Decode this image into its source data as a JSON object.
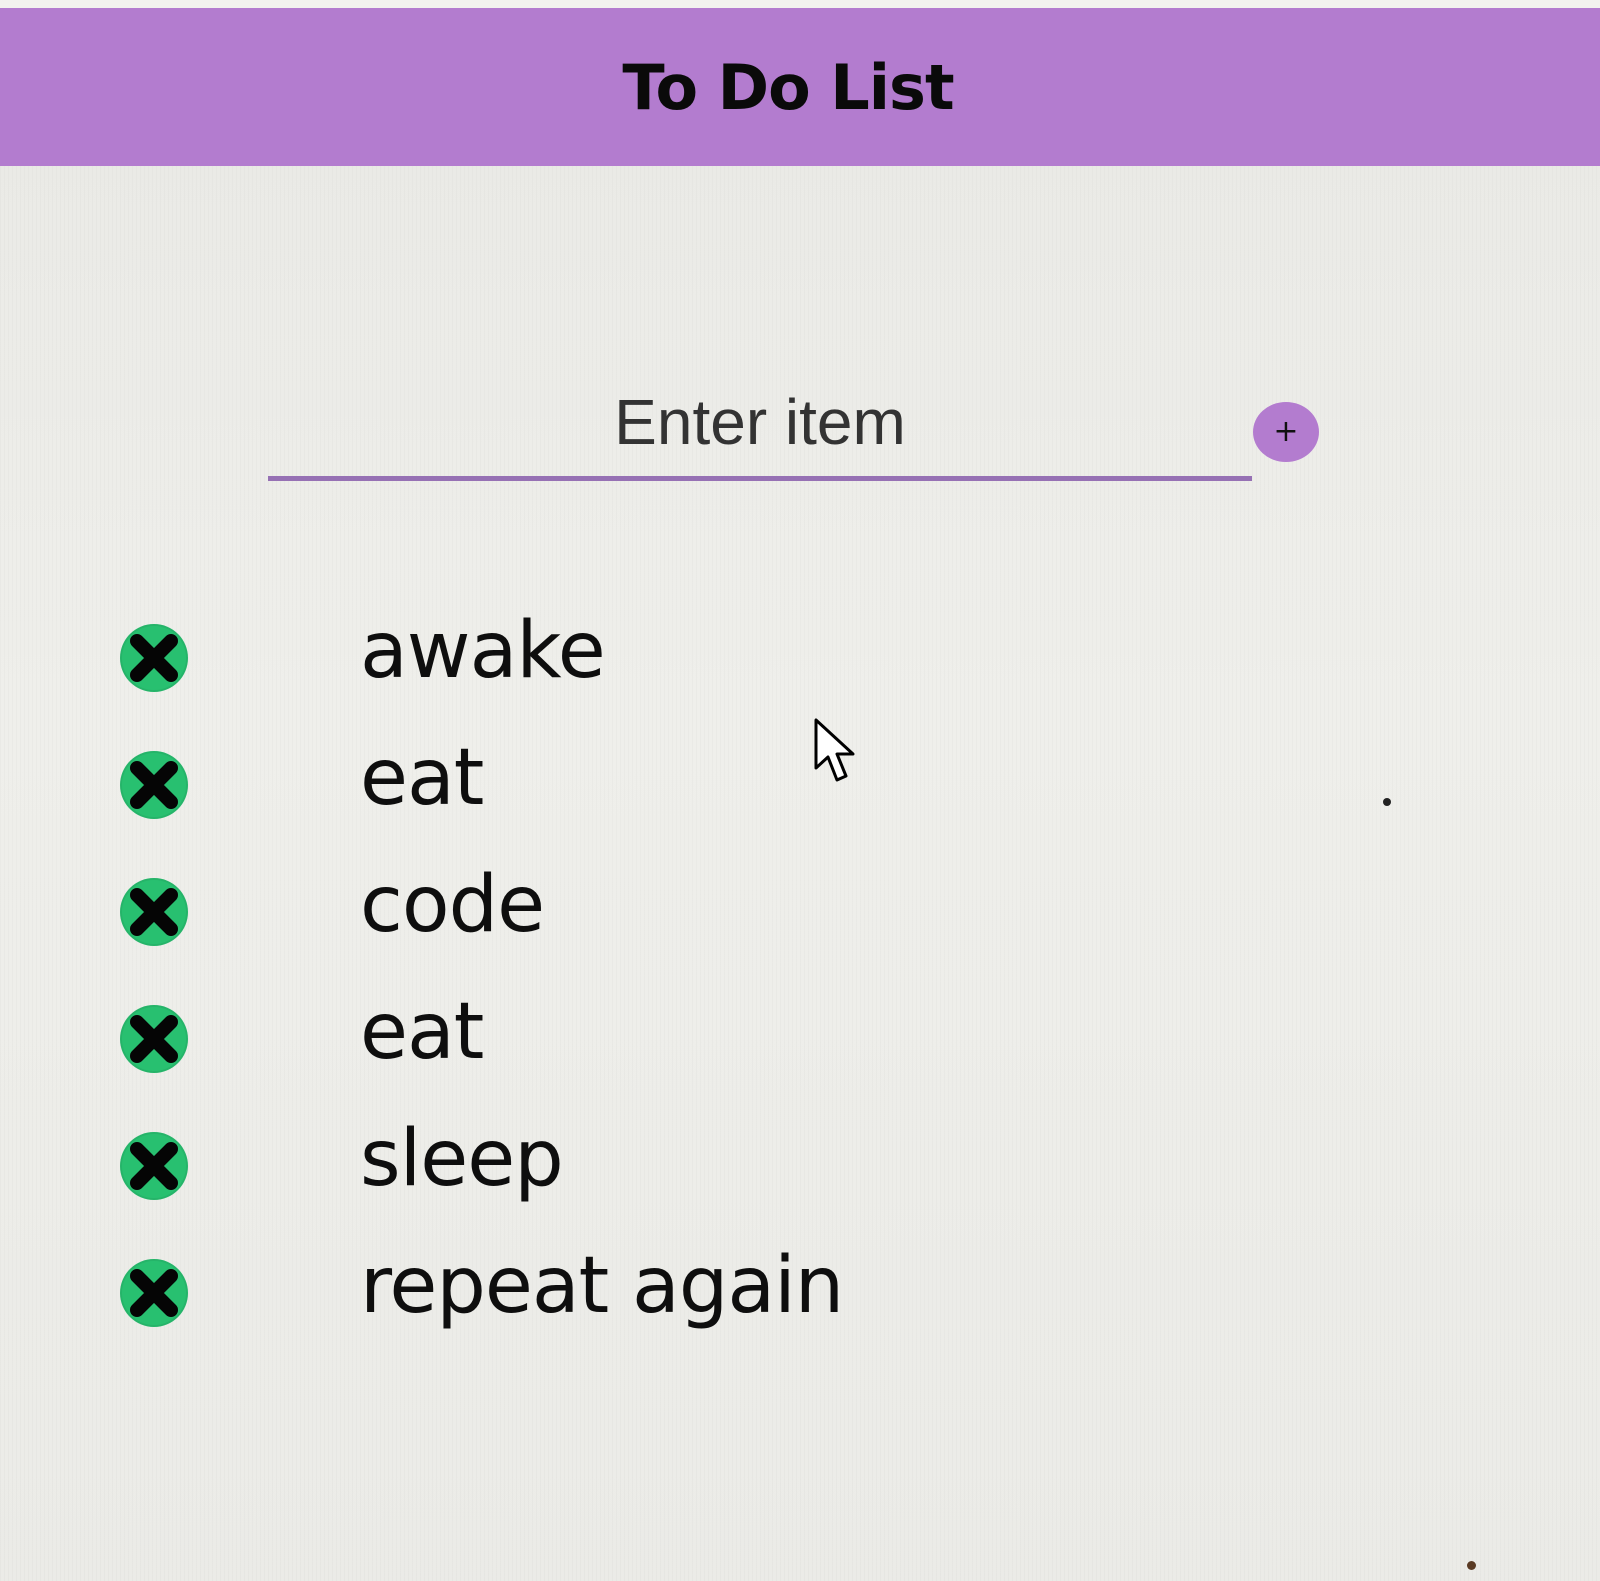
{
  "header": {
    "title": "To Do List"
  },
  "entry": {
    "placeholder": "Enter item",
    "value": "",
    "add_button_label": "+",
    "add_button_icon": "plus-icon"
  },
  "items": [
    {
      "label": "awake",
      "delete_icon": "close-circle-icon"
    },
    {
      "label": "eat",
      "delete_icon": "close-circle-icon"
    },
    {
      "label": "code",
      "delete_icon": "close-circle-icon"
    },
    {
      "label": "eat",
      "delete_icon": "close-circle-icon"
    },
    {
      "label": "sleep",
      "delete_icon": "close-circle-icon"
    },
    {
      "label": "repeat again",
      "delete_icon": "close-circle-icon"
    }
  ],
  "colors": {
    "header_bg": "#b37ccf",
    "accent": "#9671b4",
    "delete_bg": "#28c070",
    "page_bg": "#ecece8"
  }
}
